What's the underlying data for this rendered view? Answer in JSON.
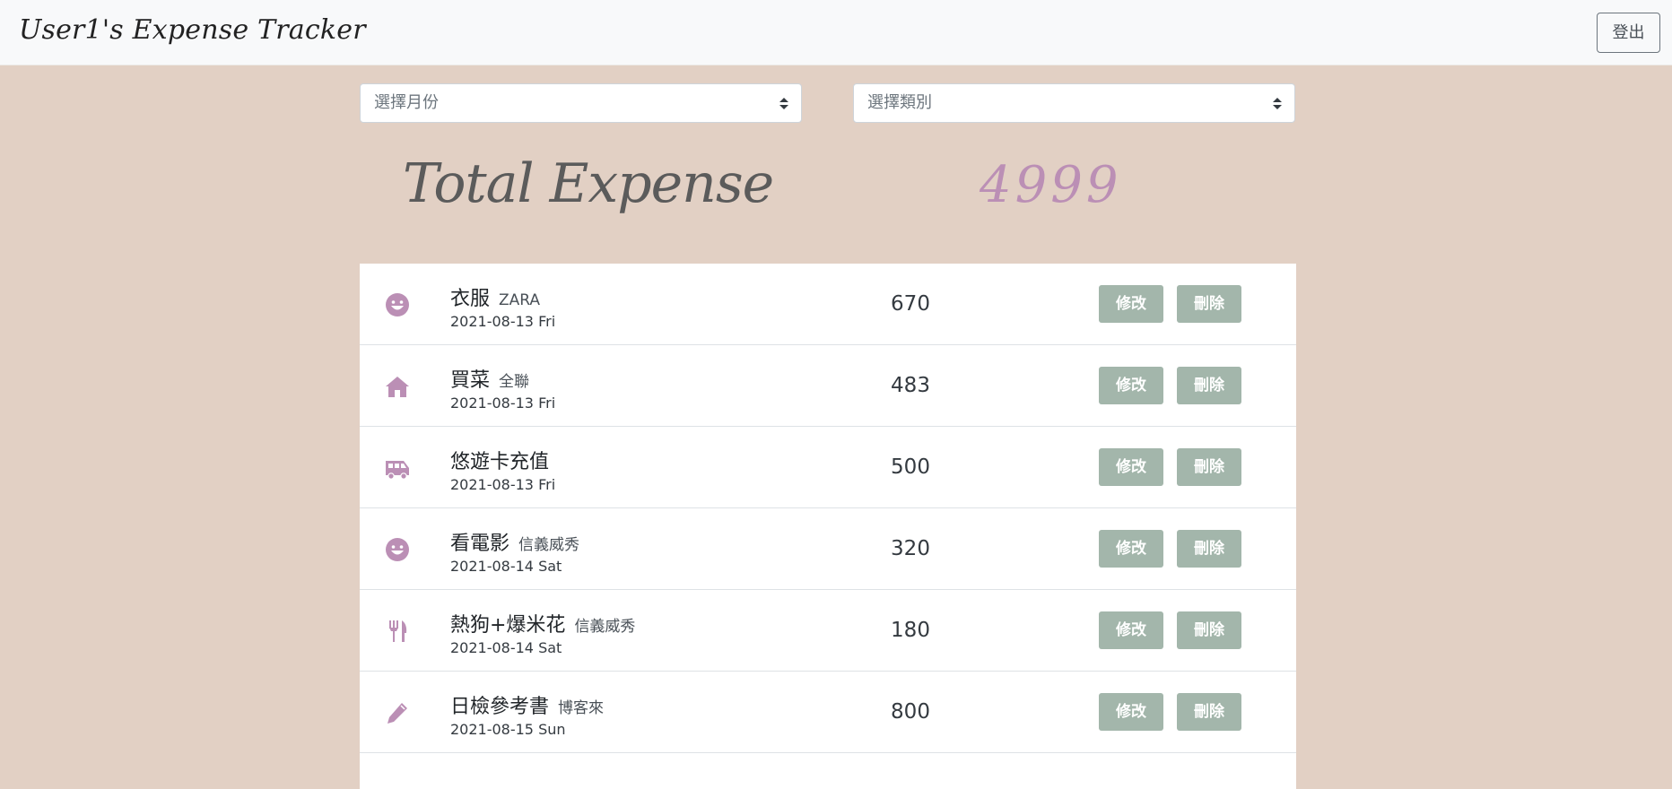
{
  "navbar": {
    "brand": "User1's Expense Tracker",
    "logout_label": "登出"
  },
  "filters": {
    "month_placeholder": "選擇月份",
    "category_placeholder": "選擇類別"
  },
  "summary": {
    "label": "Total Expense",
    "amount": "4999"
  },
  "colors": {
    "accent_icon": "#bb8fb5",
    "button": "#a3b6ab",
    "background": "#e2d0c4"
  },
  "records": [
    {
      "icon": "smile-icon",
      "name": "衣服",
      "merchant": "ZARA",
      "date": "2021-08-13 Fri",
      "amount": "670",
      "edit_label": "修改",
      "delete_label": "刪除"
    },
    {
      "icon": "home-icon",
      "name": "買菜",
      "merchant": "全聯",
      "date": "2021-08-13 Fri",
      "amount": "483",
      "edit_label": "修改",
      "delete_label": "刪除"
    },
    {
      "icon": "shuttle-van-icon",
      "name": "悠遊卡充值",
      "merchant": "",
      "date": "2021-08-13 Fri",
      "amount": "500",
      "edit_label": "修改",
      "delete_label": "刪除"
    },
    {
      "icon": "smile-icon",
      "name": "看電影",
      "merchant": "信義威秀",
      "date": "2021-08-14 Sat",
      "amount": "320",
      "edit_label": "修改",
      "delete_label": "刪除"
    },
    {
      "icon": "utensils-icon",
      "name": "熱狗+爆米花",
      "merchant": "信義威秀",
      "date": "2021-08-14 Sat",
      "amount": "180",
      "edit_label": "修改",
      "delete_label": "刪除"
    },
    {
      "icon": "pen-icon",
      "name": "日檢參考書",
      "merchant": "博客來",
      "date": "2021-08-15 Sun",
      "amount": "800",
      "edit_label": "修改",
      "delete_label": "刪除"
    }
  ]
}
